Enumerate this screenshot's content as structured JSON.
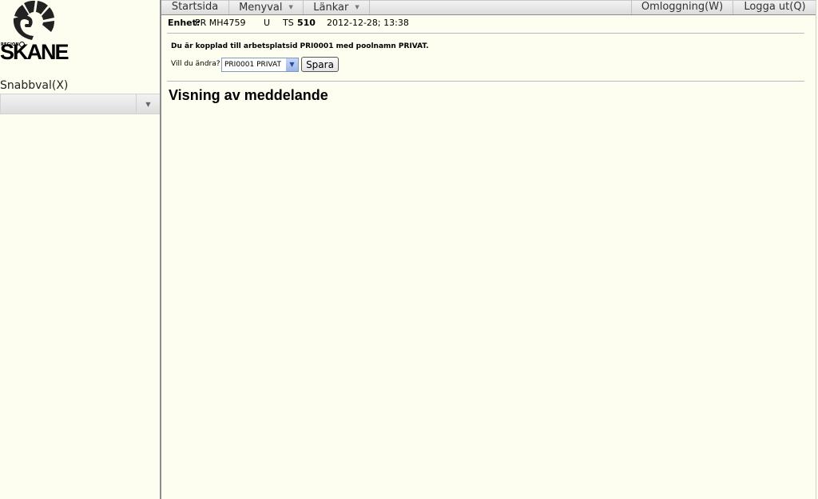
{
  "sidebar": {
    "logo": {
      "small_text": "REGION",
      "word": "SKANE"
    },
    "quick_select": {
      "label": "Snabbval(X)",
      "value": ""
    }
  },
  "menubar": {
    "items": [
      {
        "label": "Startsida"
      },
      {
        "label": "Menyval"
      },
      {
        "label": "Länkar"
      }
    ],
    "right_items": [
      {
        "label": "Omloggning(W)"
      },
      {
        "label": "Logga ut(Q)"
      }
    ]
  },
  "header": {
    "unit_label": "Enhet:",
    "unit_value": "PR MH4759",
    "flag": "U",
    "ts_label": "TS",
    "ts_value": "510",
    "datetime": "2012-12-28; 13:38"
  },
  "workplace": {
    "connected_text": "Du är kopplad till arbetsplatsid PRI0001 med poolnamn PRIVAT.",
    "change_label": "Vill du ändra?",
    "selected_pool": "PRI0001 PRIVAT",
    "save_label": "Spara"
  },
  "main": {
    "title": "Visning av meddelande"
  },
  "colors": {
    "background": "#fdfdf0",
    "divider": "#8c8c8c"
  }
}
